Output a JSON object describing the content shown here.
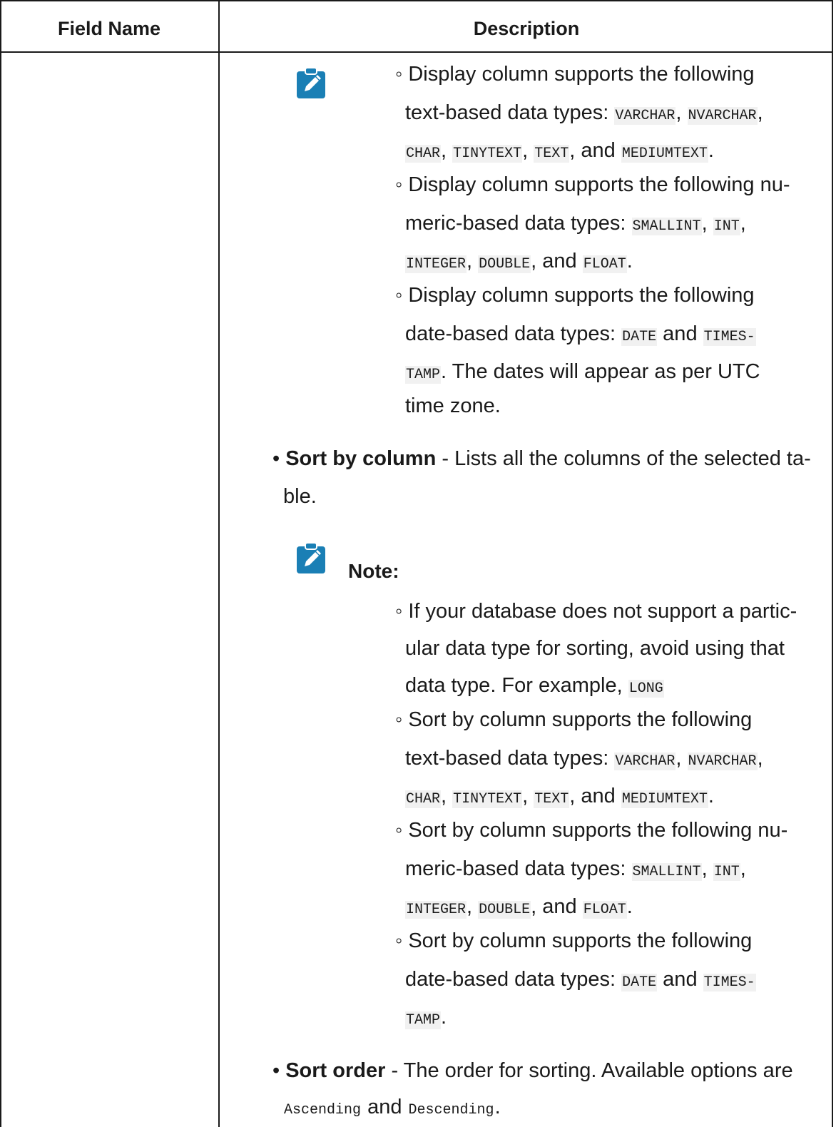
{
  "header": {
    "field_name": "Field Name",
    "description": "Description"
  },
  "block1": {
    "items": [
      {
        "parts": [
          "◦ Display column supports the following"
        ],
        "mono": []
      },
      {
        "l2_pre": "text-based data types: ",
        "m1": "VARCHAR",
        "s1": ", ",
        "m2": "NVARCHAR",
        "s2": ","
      },
      {
        "m1": "CHAR",
        "s1": ", ",
        "m2": "TINYTEXT",
        "s2": ", ",
        "m3": "TEXT",
        "s3": ", and ",
        "m4": "MEDIUMTEXT",
        "s4": "."
      }
    ],
    "line1": "◦ Display column supports the following",
    "line2_pre": "text-based data types: ",
    "line2_m1": "VARCHAR",
    "line2_s1": ", ",
    "line2_m2": "NVARCHAR",
    "line2_s2": ",",
    "line3_m1": "CHAR",
    "line3_s1": ", ",
    "line3_m2": "TINYTEXT",
    "line3_s2": ", ",
    "line3_m3": "TEXT",
    "line3_s3": ", and ",
    "line3_m4": "MEDIUMTEXT",
    "line3_s4": ".",
    "line4": "◦ Display column supports the following nu-",
    "line5_pre": "meric-based data types: ",
    "line5_m1": "SMALLINT",
    "line5_s1": ", ",
    "line5_m2": "INT",
    "line5_s2": ",",
    "line6_m1": "INTEGER",
    "line6_s1": ", ",
    "line6_m2": "DOUBLE",
    "line6_s2": ", and ",
    "line6_m3": "FLOAT",
    "line6_s3": ".",
    "line7": "◦ Display column supports the following",
    "line8_pre": "date-based data types: ",
    "line8_m1": "DATE",
    "line8_s1": " and ",
    "line8_m2": "TIMES-",
    "line9_m1": "TAMP",
    "line9_s1": ". The dates will appear as per UTC",
    "line10": "time zone."
  },
  "sort_by": {
    "bullet": "• ",
    "title": "Sort by column",
    "rest": " - Lists all the columns of the selected ta-",
    "cont": "ble."
  },
  "note": {
    "label": "Note:",
    "line1": "◦ If your database does not support a partic-",
    "line2": "ular data type for sorting, avoid using that",
    "line3_pre": "data type. For example, ",
    "line3_m1": "LONG",
    "line4": "◦ Sort by column supports the following",
    "line5_pre": "text-based data types: ",
    "line5_m1": "VARCHAR",
    "line5_s1": ", ",
    "line5_m2": "NVARCHAR",
    "line5_s2": ",",
    "line6_m1": "CHAR",
    "line6_s1": ", ",
    "line6_m2": "TINYTEXT",
    "line6_s2": ", ",
    "line6_m3": "TEXT",
    "line6_s3": ", and ",
    "line6_m4": "MEDIUMTEXT",
    "line6_s4": ".",
    "line7": "◦ Sort by column supports the following nu-",
    "line8_pre": "meric-based data types: ",
    "line8_m1": "SMALLINT",
    "line8_s1": ", ",
    "line8_m2": "INT",
    "line8_s2": ",",
    "line9_m1": "INTEGER",
    "line9_s1": ", ",
    "line9_m2": "DOUBLE",
    "line9_s2": ", and ",
    "line9_m3": "FLOAT",
    "line9_s3": ".",
    "line10": "◦ Sort by column supports the following",
    "line11_pre": "date-based data types: ",
    "line11_m1": "DATE",
    "line11_s1": " and ",
    "line11_m2": "TIMES-",
    "line12_m1": "TAMP",
    "line12_s1": "."
  },
  "sort_order": {
    "bullet": "• ",
    "title": "Sort order",
    "rest": " - The order for sorting. Available options are",
    "m1": "Ascending",
    "s1": " and ",
    "m2": "Descending",
    "s2": "."
  },
  "icons": {
    "note": "pencil-clipboard-icon",
    "color": "#1a7fb5"
  }
}
